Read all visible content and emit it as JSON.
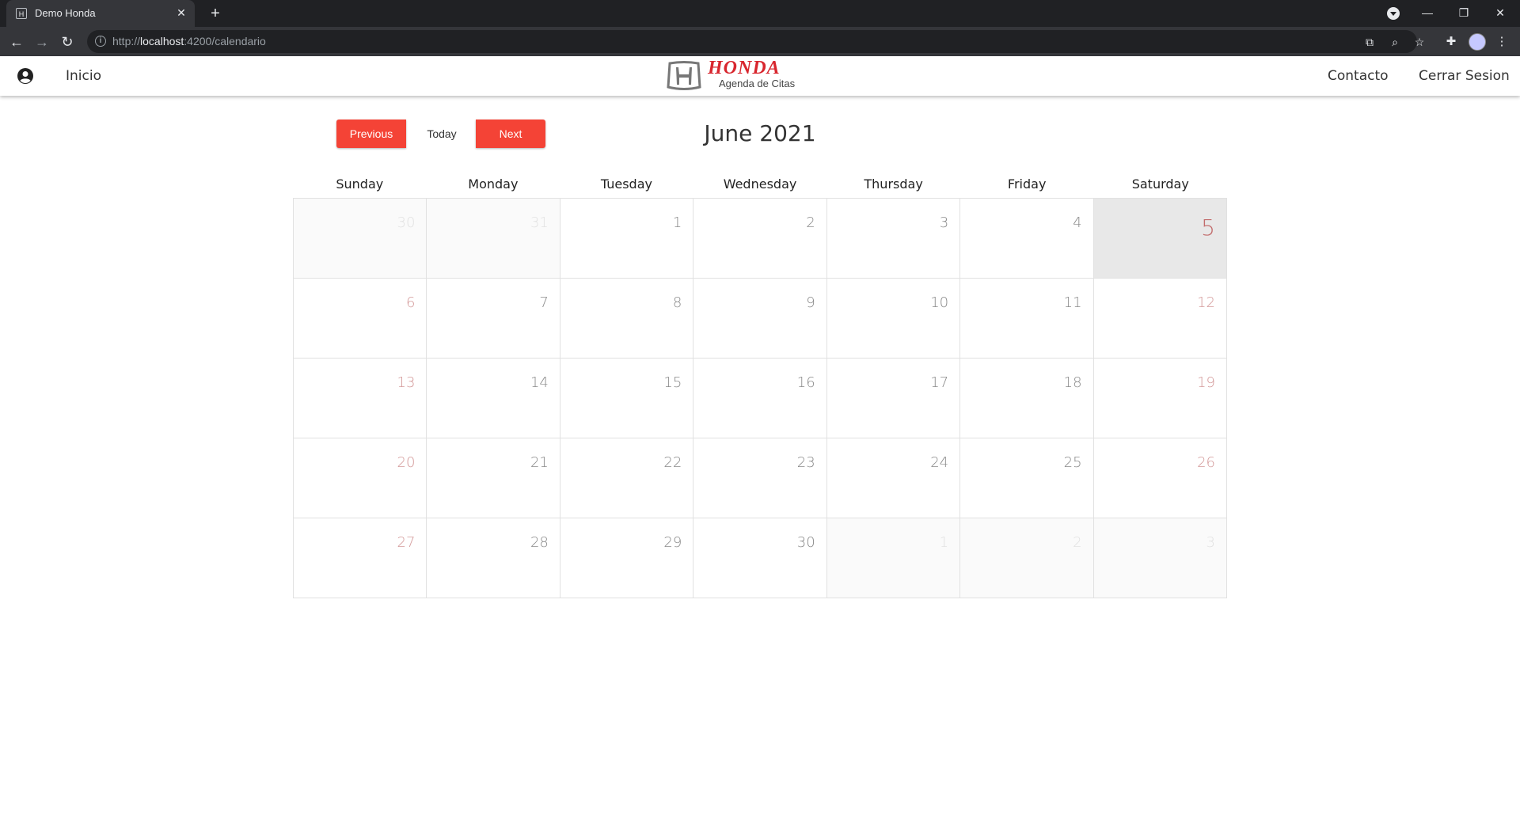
{
  "browser": {
    "tab_title": "Demo Honda",
    "tab_favicon": "honda-favicon",
    "url_protocol": "http://",
    "url_host": "localhost",
    "url_path": ":4200/calendario"
  },
  "navbar": {
    "home_label": "Inicio",
    "contact_label": "Contacto",
    "logout_label": "Cerrar Sesion",
    "brand_word": "HONDA",
    "brand_subtitle": "Agenda de Citas",
    "brand_color": "#d8262e"
  },
  "calendar": {
    "title": "June 2021",
    "prev_label": "Previous",
    "today_label": "Today",
    "next_label": "Next",
    "accent_color": "#f44336",
    "weekdays": [
      "Sunday",
      "Monday",
      "Tuesday",
      "Wednesday",
      "Thursday",
      "Friday",
      "Saturday"
    ],
    "days": [
      {
        "n": "30",
        "other": true
      },
      {
        "n": "31",
        "other": true
      },
      {
        "n": "1"
      },
      {
        "n": "2"
      },
      {
        "n": "3"
      },
      {
        "n": "4"
      },
      {
        "n": "5",
        "today": true
      },
      {
        "n": "6"
      },
      {
        "n": "7"
      },
      {
        "n": "8"
      },
      {
        "n": "9"
      },
      {
        "n": "10"
      },
      {
        "n": "11"
      },
      {
        "n": "12"
      },
      {
        "n": "13"
      },
      {
        "n": "14"
      },
      {
        "n": "15"
      },
      {
        "n": "16"
      },
      {
        "n": "17"
      },
      {
        "n": "18"
      },
      {
        "n": "19"
      },
      {
        "n": "20"
      },
      {
        "n": "21"
      },
      {
        "n": "22"
      },
      {
        "n": "23"
      },
      {
        "n": "24"
      },
      {
        "n": "25"
      },
      {
        "n": "26"
      },
      {
        "n": "27"
      },
      {
        "n": "28"
      },
      {
        "n": "29"
      },
      {
        "n": "30"
      },
      {
        "n": "1",
        "other": true
      },
      {
        "n": "2",
        "other": true
      },
      {
        "n": "3",
        "other": true
      }
    ]
  }
}
